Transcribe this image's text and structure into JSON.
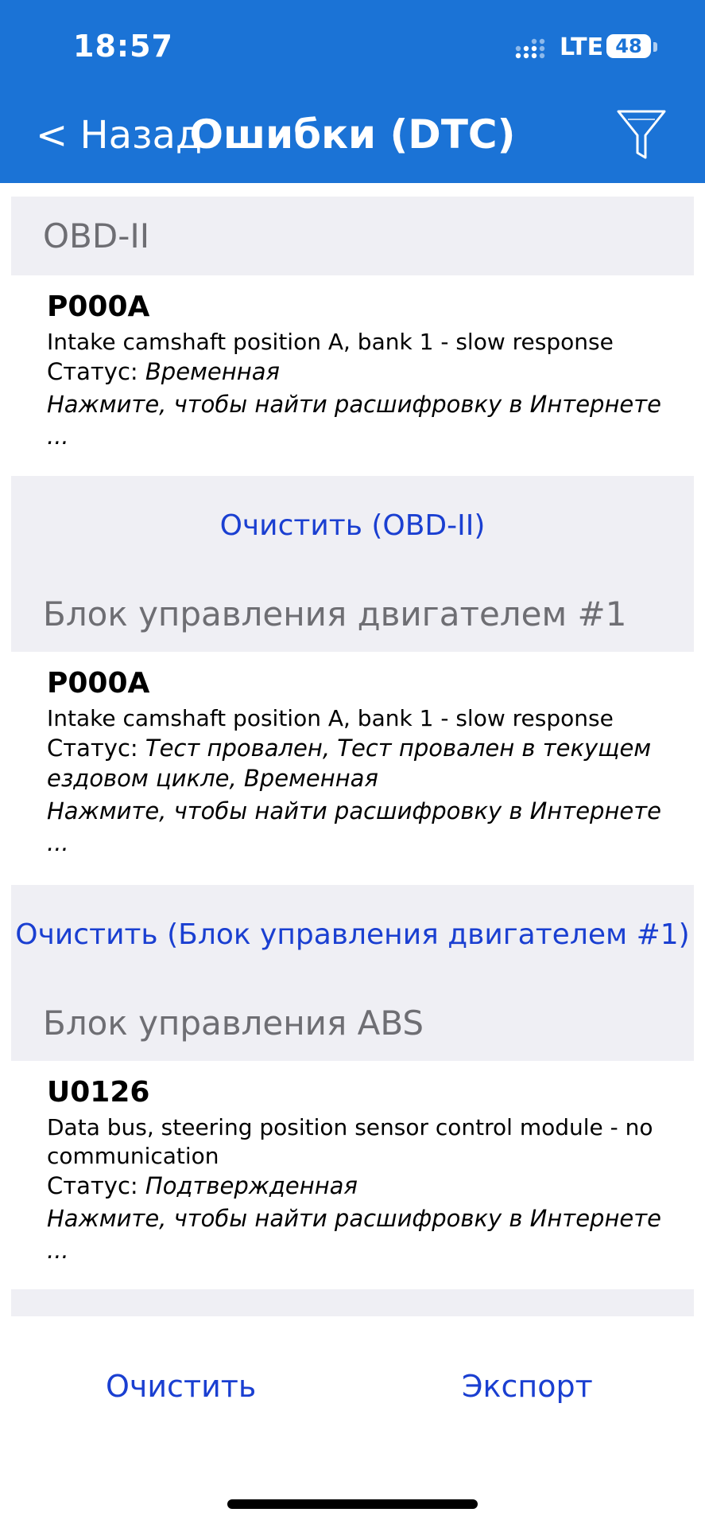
{
  "status_bar": {
    "time": "18:57",
    "network": "LTE",
    "battery": "48"
  },
  "nav": {
    "back_label": "< Назад",
    "title": "Ошибки (DTC)",
    "filter_icon": "filter-icon"
  },
  "sections": [
    {
      "title": "OBD-II",
      "items": [
        {
          "code": "P000A",
          "description": "Intake camshaft position A, bank 1 - slow response",
          "status_label": "Статус:",
          "status_value": "Временная",
          "link": "Нажмите, чтобы найти расшифровку в Интернете ..."
        }
      ],
      "clear_label": "Очистить (OBD-II)"
    },
    {
      "title": "Блок управления двигателем #1",
      "items": [
        {
          "code": "P000A",
          "description": "Intake camshaft position A, bank 1 - slow response",
          "status_label": "Статус:",
          "status_value": "Тест провален, Тест провален в текущем ездовом цикле, Временная",
          "link": "Нажмите, чтобы найти расшифровку в Интернете ..."
        }
      ],
      "clear_label": "Очистить (Блок управления двигателем #1)"
    },
    {
      "title": "Блок управления ABS",
      "items": [
        {
          "code": "U0126",
          "description": "Data bus, steering position sensor control module - no communication",
          "status_label": "Статус:",
          "status_value": "Подтвержденная",
          "link": "Нажмите, чтобы найти расшифровку в Интернете ..."
        }
      ]
    }
  ],
  "footer": {
    "clear_label": "Очистить",
    "export_label": "Экспорт"
  },
  "colors": {
    "header_bg": "#1b73d6",
    "section_bg": "#efeff4",
    "link_blue": "#1a3fd1",
    "section_title": "#6e6e73"
  }
}
